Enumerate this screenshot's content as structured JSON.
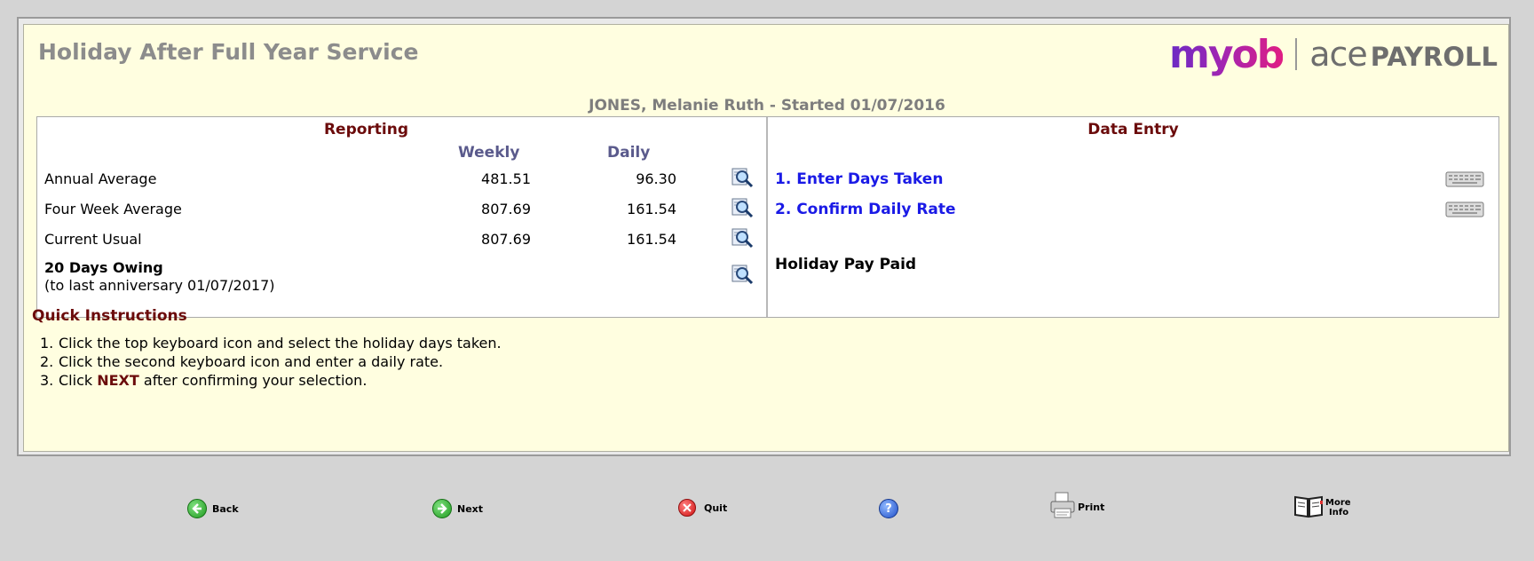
{
  "window": {
    "title": "Holiday After Full Year Service",
    "brand": {
      "primary": "myob",
      "product_a": "ace",
      "product_b": "PAYROLL"
    }
  },
  "employee": "JONES, Melanie Ruth - Started 01/07/2016",
  "reporting": {
    "heading": "Reporting",
    "columns": {
      "weekly": "Weekly",
      "daily": "Daily"
    },
    "rows": [
      {
        "label": "Annual Average",
        "weekly": "481.51",
        "daily": "96.30",
        "icon": "magnifier-icon"
      },
      {
        "label": "Four Week Average",
        "weekly": "807.69",
        "daily": "161.54",
        "icon": "magnifier-icon"
      },
      {
        "label": "Current Usual",
        "weekly": "807.69",
        "daily": "161.54",
        "icon": "magnifier-icon"
      }
    ],
    "owing": {
      "label": "20 Days Owing",
      "sub": "(to last anniversary 01/07/2017)"
    }
  },
  "data_entry": {
    "heading": "Data Entry",
    "items": [
      {
        "label": "1. Enter Days Taken",
        "icon": "keyboard-icon"
      },
      {
        "label": "2. Confirm Daily Rate",
        "icon": "keyboard-icon"
      }
    ],
    "paid_label": "Holiday Pay Paid"
  },
  "quick_instructions": {
    "title": "Quick Instructions",
    "steps": [
      {
        "num": "1.",
        "text": "Click the top keyboard icon and select the holiday days taken."
      },
      {
        "num": "2.",
        "text": "Click the second keyboard icon and enter a daily rate."
      },
      {
        "num": "3.",
        "pre": "Click ",
        "strong": "NEXT",
        "post": " after confirming your selection."
      }
    ]
  },
  "toolbar": {
    "back": "Back",
    "next": "Next",
    "quit": "Quit",
    "help": "?",
    "print": "Print",
    "more_info_line1": "More",
    "more_info_line2": "Info"
  },
  "colors": {
    "panel_bg": "#fffee0",
    "heading_red": "#6b0b0b",
    "link_blue": "#1a1ae6",
    "column_head": "#5a5a8c"
  }
}
